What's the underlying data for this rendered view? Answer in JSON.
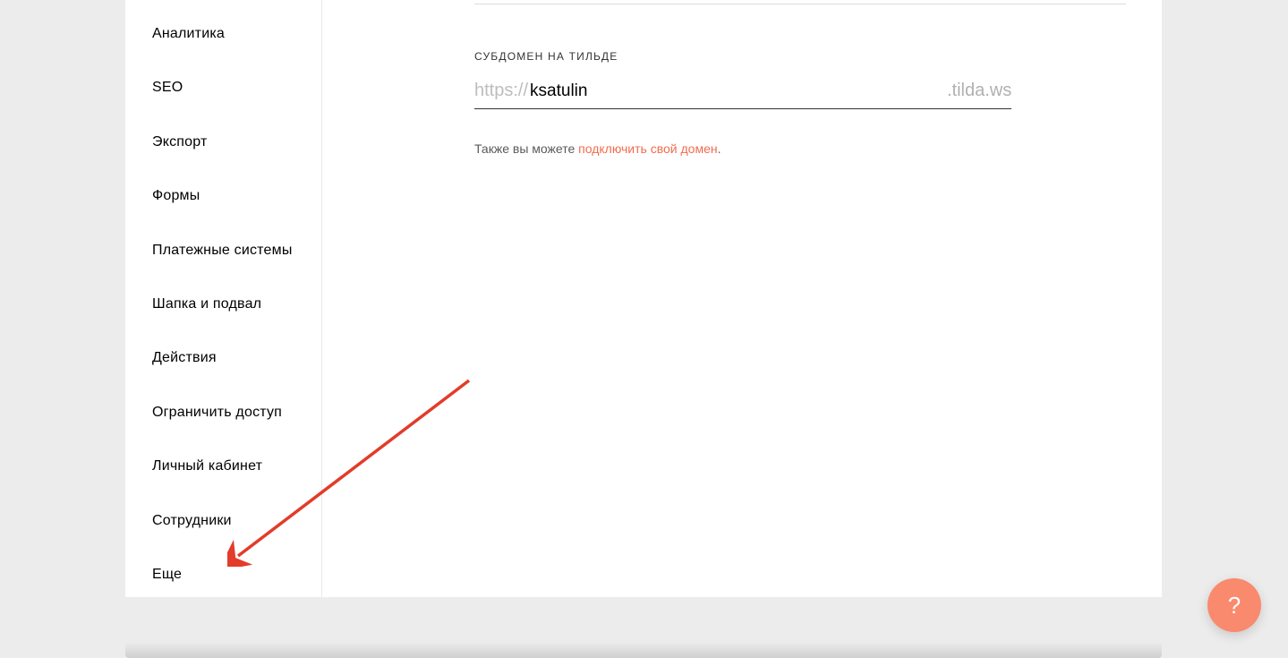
{
  "sidebar": {
    "items": [
      {
        "label": "Аналитика"
      },
      {
        "label": "SEO"
      },
      {
        "label": "Экспорт"
      },
      {
        "label": "Формы"
      },
      {
        "label": "Платежные системы"
      },
      {
        "label": "Шапка и подвал"
      },
      {
        "label": "Действия"
      },
      {
        "label": "Ограничить доступ"
      },
      {
        "label": "Личный кабинет"
      },
      {
        "label": "Сотрудники"
      },
      {
        "label": "Еще"
      }
    ]
  },
  "main": {
    "subdomain": {
      "label": "СУБДОМЕН НА ТИЛЬДЕ",
      "prefix": "https://",
      "value": "ksatulin",
      "suffix": ".tilda.ws"
    },
    "hint": {
      "before": "Также вы можете ",
      "link": "подключить свой домен",
      "after": "."
    }
  },
  "help": {
    "label": "?"
  }
}
